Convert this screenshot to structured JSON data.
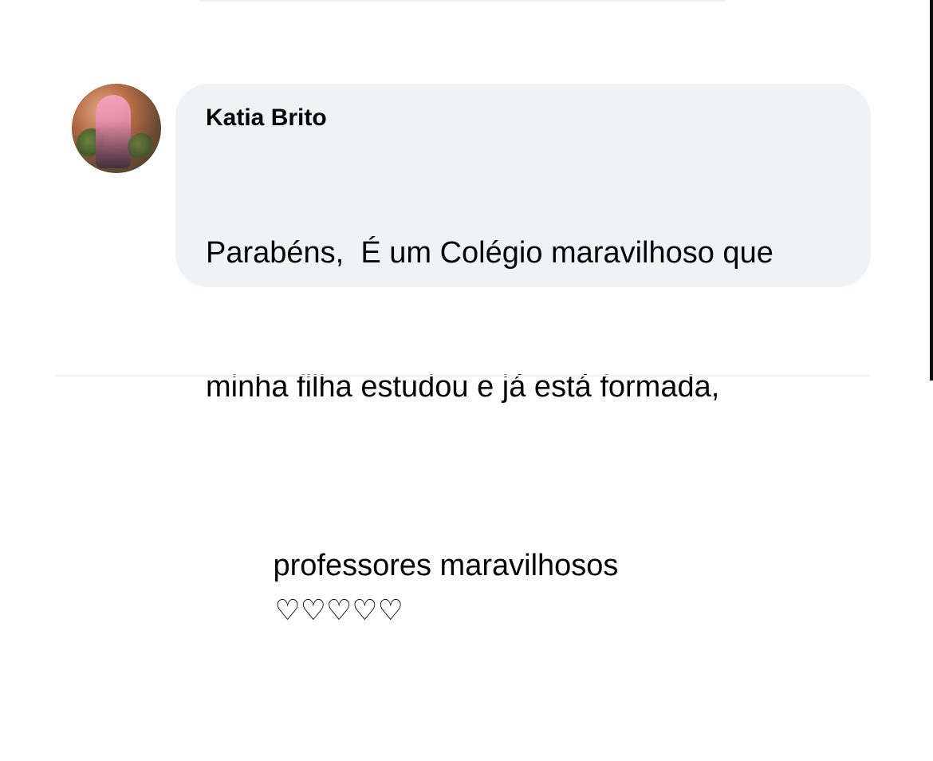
{
  "comment": {
    "author": "Katia Brito",
    "lines": [
      "Parabéns,  É um Colégio maravilhoso que",
      "minha filha estudou e já está formada,",
      "professores maravilhosos"
    ],
    "emoji": "♡♡♡♡♡"
  },
  "colors": {
    "bubble_bg": "#f0f2f5",
    "text": "#050505",
    "page_bg": "#ffffff"
  },
  "icons": {
    "avatar": "profile-photo",
    "emoji_heart": "white-heart"
  }
}
